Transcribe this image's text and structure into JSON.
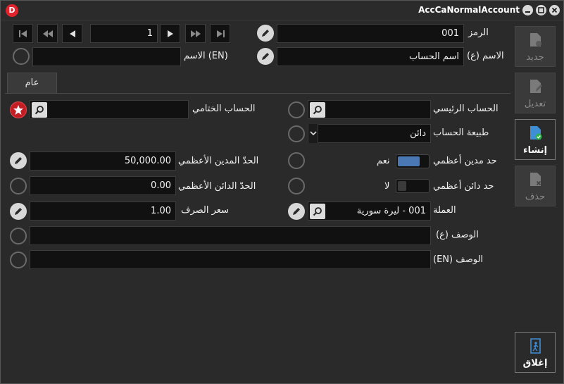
{
  "window": {
    "title": "AccCaNormalAccount",
    "logo": "D"
  },
  "nav": {
    "record_number": "1"
  },
  "header": {
    "code_label": "الرمز",
    "code_value": "001",
    "name_ar_label": "الاسم (ع)",
    "name_ar_value": "اسم الحساب",
    "name_en_label": "الاسم (EN)",
    "name_en_value": ""
  },
  "tabs": [
    {
      "label": "عام"
    }
  ],
  "form": {
    "main_account_label": "الحساب الرئيسي",
    "main_account_value": "",
    "final_account_label": "الحساب الختامي",
    "final_account_value": "",
    "account_nature_label": "طبيعة الحساب",
    "account_nature_value": "دائن",
    "max_debit_label": "حد مدين أعظمي",
    "max_debit_toggle_text": "نعم",
    "max_debit_toggle_on": true,
    "max_debit_limit_label": "الحدّ المدين الأعظمي",
    "max_debit_limit_value": "50,000.00",
    "max_credit_label": "حد دائن أعظمي",
    "max_credit_toggle_text": "لا",
    "max_credit_toggle_on": false,
    "max_credit_limit_label": "الحدّ الدائن الأعظمي",
    "max_credit_limit_value": "0.00",
    "currency_label": "العملة",
    "currency_value": "001 - ليرة سورية",
    "exchange_rate_label": "سعر الصرف",
    "exchange_rate_value": "1.00",
    "desc_ar_label": "الوصف (ع)",
    "desc_ar_value": "",
    "desc_en_label": "الوصف (EN)",
    "desc_en_value": ""
  },
  "sidebar": {
    "new_label": "جديد",
    "edit_label": "تعديل",
    "create_label": "إنشاء",
    "delete_label": "حذف",
    "close_label": "إغلاق"
  },
  "colors": {
    "accent": "#4a78b4",
    "danger": "#c41e25",
    "background": "#2a2a2a",
    "field": "#111111"
  }
}
